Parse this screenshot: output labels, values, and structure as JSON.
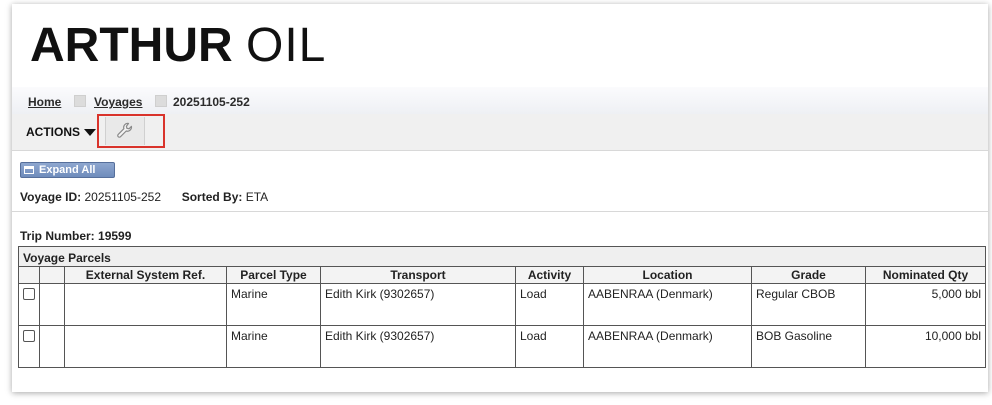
{
  "brand": {
    "logo_bold": "ARTHUR",
    "logo_light": "OIL"
  },
  "breadcrumb": [
    {
      "label": "Home"
    },
    {
      "label": "Voyages"
    },
    {
      "label": "20251105-252"
    }
  ],
  "toolbar": {
    "actions_label": "ACTIONS",
    "tool_icon": "wrench-icon",
    "highlight_color": "#d9332b"
  },
  "expand_all_label": "Expand All",
  "voyage": {
    "id_label": "Voyage ID:",
    "id_value": "20251105-252",
    "sorted_label": "Sorted By:",
    "sorted_value": "ETA"
  },
  "trip": {
    "label": "Trip Number:",
    "value": "19599"
  },
  "parcels": {
    "caption": "Voyage Parcels",
    "columns": [
      "External System Ref.",
      "Parcel Type",
      "Transport",
      "Activity",
      "Location",
      "Grade",
      "Nominated Qty"
    ],
    "rows": [
      {
        "ext_ref": "",
        "parcel_type": "Marine",
        "transport": "Edith Kirk (9302657)",
        "activity": "Load",
        "location": "AABENRAA (Denmark)",
        "grade": "Regular CBOB",
        "qty": "5,000 bbl"
      },
      {
        "ext_ref": "",
        "parcel_type": "Marine",
        "transport": "Edith Kirk (9302657)",
        "activity": "Load",
        "location": "AABENRAA (Denmark)",
        "grade": "BOB Gasoline",
        "qty": "10,000 bbl"
      }
    ]
  }
}
